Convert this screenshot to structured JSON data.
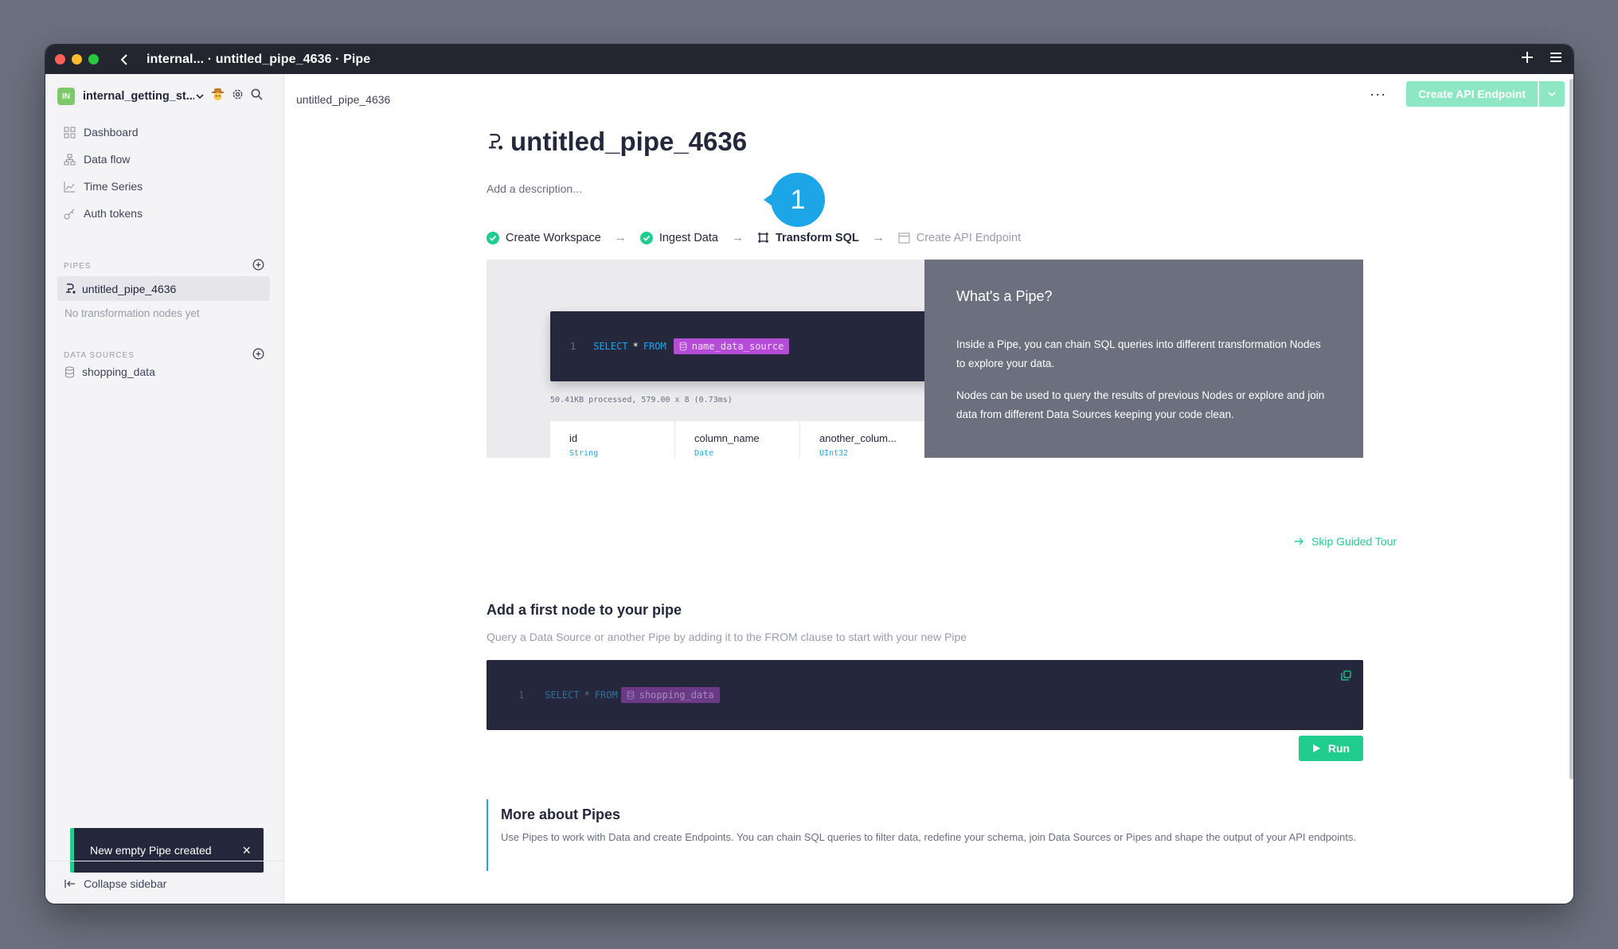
{
  "window": {
    "title": "internal... · untitled_pipe_4636 · Pipe"
  },
  "workspace": {
    "initials": "IN",
    "name": "internal_getting_st..."
  },
  "nav": [
    {
      "label": "Dashboard",
      "icon": "grid-icon"
    },
    {
      "label": "Data flow",
      "icon": "dataflow-icon"
    },
    {
      "label": "Time Series",
      "icon": "chart-line-icon"
    },
    {
      "label": "Auth tokens",
      "icon": "key-icon"
    }
  ],
  "pipes": {
    "heading": "PIPES",
    "items": [
      "untitled_pipe_4636"
    ],
    "empty_note": "No transformation nodes yet"
  },
  "data_sources": {
    "heading": "DATA SOURCES",
    "items": [
      "shopping_data"
    ]
  },
  "toast": {
    "message": "New empty Pipe created",
    "close": "×"
  },
  "sidebar_footer": {
    "collapse_label": "Collapse sidebar"
  },
  "header": {
    "breadcrumb": "untitled_pipe_4636",
    "more": "···",
    "create_endpoint_label": "Create API Endpoint"
  },
  "pipe": {
    "title": "untitled_pipe_4636",
    "description_placeholder": "Add a description...",
    "step_bubble": "1"
  },
  "steps": [
    {
      "label": "Create Workspace",
      "status": "done"
    },
    {
      "label": "Ingest Data",
      "status": "done"
    },
    {
      "label": "Transform SQL",
      "status": "current"
    },
    {
      "label": "Create API Endpoint",
      "status": "pending"
    }
  ],
  "tour": {
    "code": {
      "line": "1",
      "select": "SELECT",
      "star": "*",
      "from": "FROM",
      "source": "name_data_source"
    },
    "processed": "50.41KB processed, 579.00 x 8 (0.73ms)",
    "columns": [
      {
        "name": "id",
        "type": "String"
      },
      {
        "name": "column_name",
        "type": "Date"
      },
      {
        "name": "another_colum...",
        "type": "UInt32"
      }
    ],
    "panel_title": "What's a Pipe?",
    "panel_p1": "Inside a Pipe, you can chain SQL queries into different transformation Nodes to explore your data.",
    "panel_p2": "Nodes can be used to query the results of previous Nodes or explore and join data from different Data Sources keeping your code clean.",
    "skip_label": "Skip Guided Tour"
  },
  "first_node": {
    "heading": "Add a first node to your pipe",
    "subtitle": "Query a Data Source or another Pipe by adding it to the FROM clause to start with your new Pipe",
    "code": {
      "line": "1",
      "select": "SELECT",
      "star": "*",
      "from": "FROM",
      "source": "shopping_data"
    },
    "run_label": "Run"
  },
  "more": {
    "heading": "More about Pipes",
    "text": "Use Pipes to work with Data and create Endpoints. You can chain SQL queries to filter data, redefine your schema, join Data Sources or Pipes and shape the output of your API endpoints."
  },
  "colors": {
    "accent_green": "#21cc8f",
    "accent_blue": "#1ca6e8",
    "dark": "#25283d",
    "datasource_purple": "#b44cd6"
  }
}
